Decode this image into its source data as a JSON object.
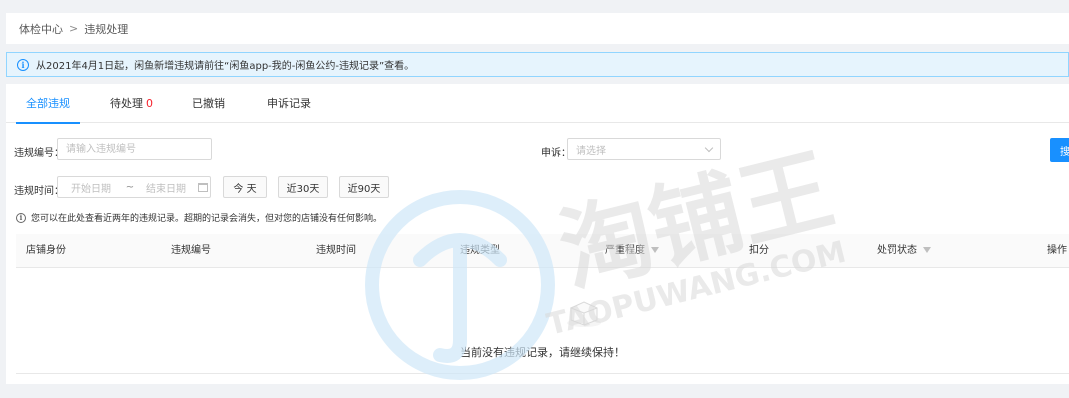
{
  "breadcrumb": {
    "root": "体检中心",
    "separator": ">",
    "current": "违规处理"
  },
  "notice": {
    "text": "从2021年4月1日起，闲鱼新增违规请前往“闲鱼app-我的-闲鱼公约-违规记录”查看。"
  },
  "tabs": [
    {
      "label": "全部违规",
      "active": true
    },
    {
      "label": "待处理",
      "count": "0"
    },
    {
      "label": "已撤销"
    },
    {
      "label": "申诉记录"
    }
  ],
  "filters": {
    "violation_no": {
      "label": "违规编号：",
      "placeholder": "请输入违规编号",
      "value": ""
    },
    "appeal": {
      "label": "申诉：",
      "placeholder": "请选择"
    },
    "time": {
      "label": "违规时间：",
      "start_placeholder": "开始日期",
      "separator": "~",
      "end_placeholder": "结束日期"
    },
    "quick": {
      "today": "今 天",
      "last30": "近30天",
      "last90": "近90天"
    },
    "search_button": "搜索"
  },
  "hint": "您可以在此处查看近两年的违规记录。超期的记录会消失，但对您的店铺没有任何影响。",
  "table": {
    "columns": [
      "店铺身份",
      "违规编号",
      "违规时间",
      "违规类型",
      "严重程度",
      "扣分",
      "处罚状态",
      "操作"
    ],
    "empty_text": "当前没有违规记录，请继续保持！"
  },
  "watermark": {
    "brand": "淘铺王",
    "domain": "TAOPUWANG.COM"
  },
  "colors": {
    "accent": "#1890ff",
    "danger": "#f5222d",
    "notice_bg": "#e6f4fd"
  }
}
